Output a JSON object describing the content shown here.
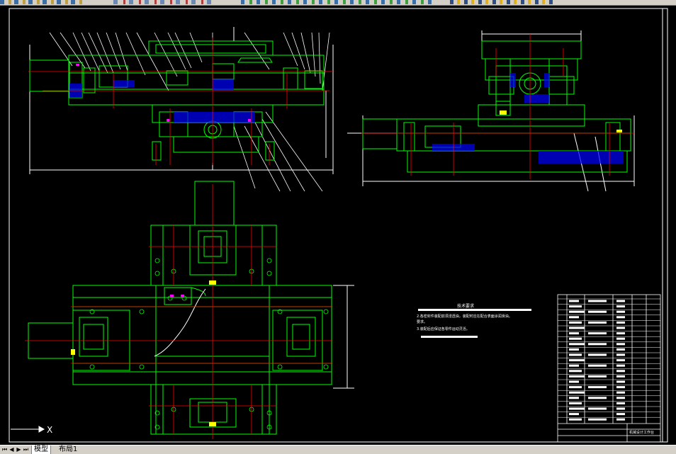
{
  "window": {
    "app": "AutoCAD"
  },
  "tabs": {
    "model": "模型",
    "layout1": "布局1"
  },
  "ucs": {
    "x_label": "X"
  },
  "drawing": {
    "tech_req_title": "技术要求",
    "tech_req": [
      "1.",
      "2.各密封件装配前须浸透油，装配时应在配合表面涂润滑油。",
      "3.装配后应保证各零件运动灵活。",
      "4."
    ],
    "tech_req_tail": "要求。",
    "title_block_name": "机械设计工作台"
  },
  "colors": {
    "bg": "#000000",
    "green": "#00ff00",
    "white": "#ffffff",
    "red": "#ff0000",
    "cyan": "#00ffff",
    "blue": "#0000ff",
    "yellow": "#ffff00",
    "magenta": "#ff00ff"
  }
}
